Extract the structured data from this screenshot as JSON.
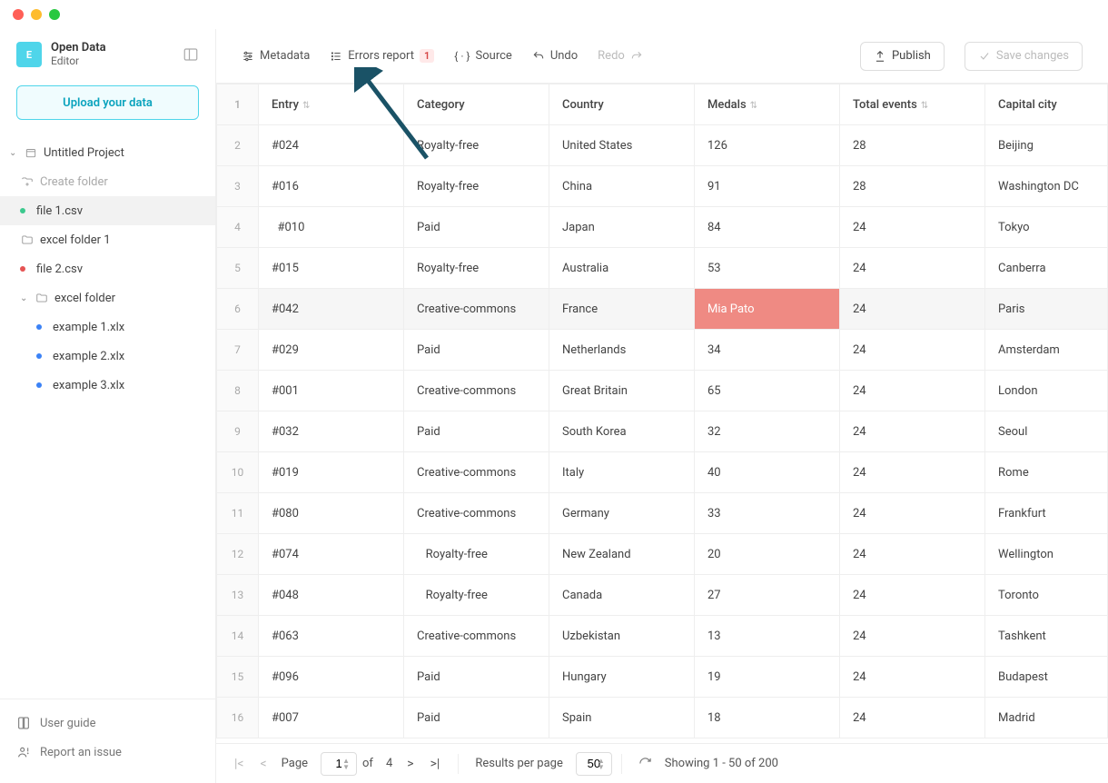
{
  "brand": {
    "title": "Open Data",
    "subtitle": "Editor",
    "logo_letter": "E"
  },
  "upload_button": "Upload your data",
  "tree": {
    "project": "Untitled Project",
    "create_folder": "Create folder",
    "items": [
      {
        "name": "file 1.csv",
        "status": "green",
        "selected": true
      },
      {
        "name": "excel folder 1",
        "type": "folder"
      },
      {
        "name": "file 2.csv",
        "status": "red"
      },
      {
        "name": "excel folder",
        "type": "folder",
        "expanded": true
      },
      {
        "name": "example 1.xlx",
        "status": "blue",
        "indent": 2
      },
      {
        "name": "example 2.xlx",
        "status": "blue",
        "indent": 2
      },
      {
        "name": "example 3.xlx",
        "status": "blue",
        "indent": 2
      }
    ]
  },
  "sidebar_footer": {
    "user_guide": "User guide",
    "report_issue": "Report an issue"
  },
  "toolbar": {
    "metadata": "Metadata",
    "errors_report": "Errors report",
    "errors_badge": "1",
    "source": "Source",
    "undo": "Undo",
    "redo": "Redo",
    "publish": "Publish",
    "save_changes": "Save changes"
  },
  "table": {
    "headers": {
      "entry": "Entry",
      "category": "Category",
      "country": "Country",
      "medals": "Medals",
      "events": "Total events",
      "city": "Capital city"
    },
    "rows": [
      {
        "n": "1",
        "entry": "#024",
        "category": "Royalty-free",
        "country": "United States",
        "medals": "126",
        "events": "28",
        "city": "Beijing"
      },
      {
        "n": "2",
        "entry": "#016",
        "category": "Royalty-free",
        "country": "China",
        "medals": "91",
        "events": "28",
        "city": "Washington DC"
      },
      {
        "n": "3",
        "entry": "#010",
        "category": "Paid",
        "country": "Japan",
        "medals": "84",
        "events": "24",
        "city": "Tokyo",
        "entry_pad": true
      },
      {
        "n": "4",
        "entry": "#015",
        "category": "Royalty-free",
        "country": "Australia",
        "medals": "53",
        "events": "24",
        "city": "Canberra"
      },
      {
        "n": "5",
        "entry": "#042",
        "category": "Creative-commons",
        "country": "France",
        "medals": "Mia Pato",
        "events": "24",
        "city": "Paris",
        "highlight": true,
        "error_col": "medals"
      },
      {
        "n": "6",
        "entry": "#029",
        "category": "Paid",
        "country": "Netherlands",
        "medals": "34",
        "events": "24",
        "city": "Amsterdam"
      },
      {
        "n": "7",
        "entry": "#001",
        "category": "Creative-commons",
        "country": "Great Britain",
        "medals": "65",
        "events": "24",
        "city": "London"
      },
      {
        "n": "8",
        "entry": "#032",
        "category": "Paid",
        "country": "South Korea",
        "medals": "32",
        "events": "24",
        "city": "Seoul"
      },
      {
        "n": "9",
        "entry": "#019",
        "category": "Creative-commons",
        "country": "Italy",
        "medals": "40",
        "events": "24",
        "city": "Rome"
      },
      {
        "n": "10",
        "entry": "#080",
        "category": "Creative-commons",
        "country": "Germany",
        "medals": "33",
        "events": "24",
        "city": "Frankfurt"
      },
      {
        "n": "11",
        "entry": "#074",
        "category": "Royalty-free",
        "country": "New Zealand",
        "medals": "20",
        "events": "24",
        "city": "Wellington",
        "cat_pad": true
      },
      {
        "n": "12",
        "entry": "#048",
        "category": "Royalty-free",
        "country": "Canada",
        "medals": "27",
        "events": "24",
        "city": "Toronto",
        "cat_pad": true
      },
      {
        "n": "13",
        "entry": "#063",
        "category": "Creative-commons",
        "country": "Uzbekistan",
        "medals": "13",
        "events": "24",
        "city": "Tashkent"
      },
      {
        "n": "14",
        "entry": "#096",
        "category": "Paid",
        "country": "Hungary",
        "medals": "19",
        "events": "24",
        "city": "Budapest"
      },
      {
        "n": "15",
        "entry": "#007",
        "category": "Paid",
        "country": "Spain",
        "medals": "18",
        "events": "24",
        "city": "Madrid"
      }
    ]
  },
  "pager": {
    "page_label": "Page",
    "page_value": "1",
    "of_label": "of",
    "total_pages": "4",
    "results_label": "Results per page",
    "per_page_value": "50",
    "showing": "Showing 1 - 50 of 200"
  }
}
